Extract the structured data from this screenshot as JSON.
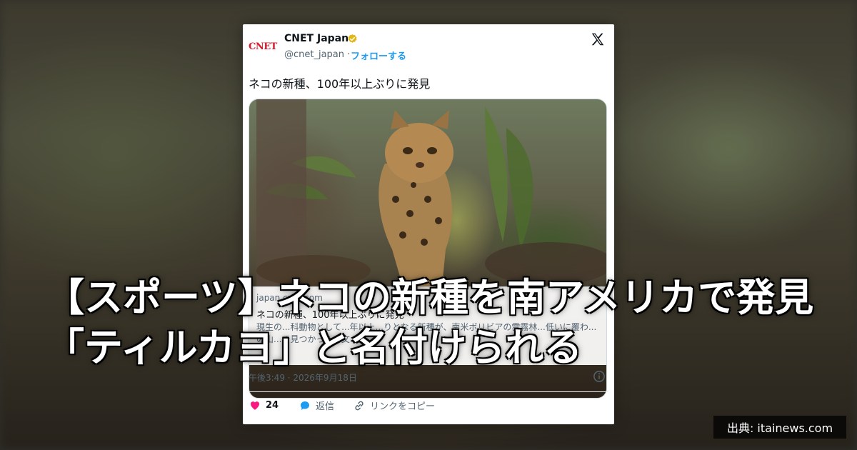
{
  "tweet": {
    "account_name": "CNET Japan",
    "logo_text": "CNET",
    "handle": "@cnet_japan ·",
    "follow_label": "フォローする",
    "text": "ネコの新種、100年以上ぶりに発見",
    "link_card": {
      "domain": "japan.cnet.com",
      "title": "ネコの新種、100年以上ぶりに発見",
      "description": "現生の...科動物として...年以上...りとなる新種が、南米ボリビアの雲霧林...低いに覆わ...の山...で見つかった...文..."
    },
    "timestamp": "午後3:49 · 2026年9月18日",
    "like_count": "24",
    "reply_label": "返信",
    "copy_link_label": "リンクをコピー",
    "icons": [
      "verified-badge-icon",
      "x-logo-icon",
      "info-icon",
      "heart-icon",
      "reply-icon",
      "link-icon"
    ]
  },
  "headline": "【スポーツ】ネコの新種を南アメリカで発見　「ティルカヨ」と名付けられる",
  "source_badge": "出典: itainews.com",
  "colors": {
    "accent_blue": "#1d9bf0",
    "like_pink": "#f91880",
    "cnet_red": "#d7192c",
    "verified_gold": "#e2b719"
  }
}
